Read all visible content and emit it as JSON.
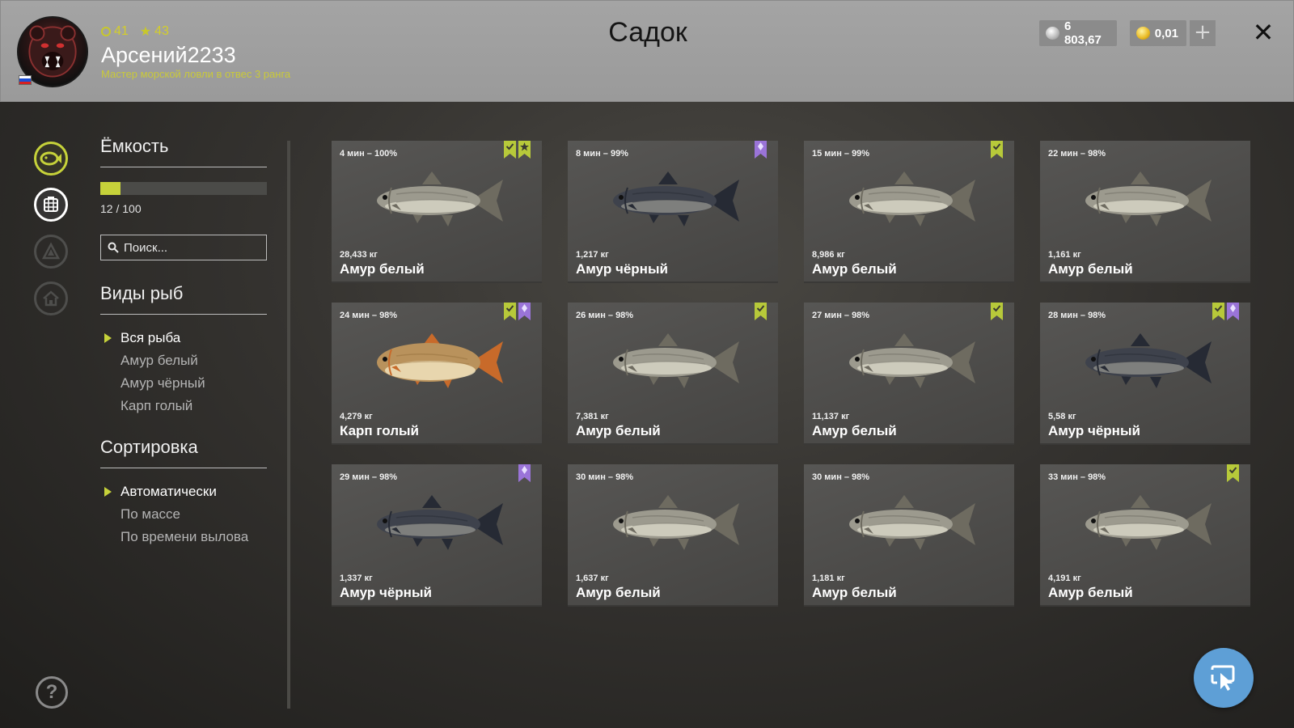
{
  "header": {
    "title": "Садок",
    "player": {
      "name": "Арсений2233",
      "level": "41",
      "rank": "43",
      "title": "Мастер морской ловли в отвес 3 ранга"
    },
    "currency": {
      "silver": "6 803,67",
      "gold": "0,01"
    },
    "add_button": "+",
    "close_button": "✕"
  },
  "sidebar": {
    "capacity_title": "Ёмкость",
    "capacity_text": "12 / 100",
    "capacity_fill": 0.12,
    "search_placeholder": "Поиск...",
    "species_title": "Виды рыб",
    "species": [
      {
        "label": "Вся рыба",
        "active": true
      },
      {
        "label": "Амур белый",
        "active": false
      },
      {
        "label": "Амур чёрный",
        "active": false
      },
      {
        "label": "Карп голый",
        "active": false
      }
    ],
    "sort_title": "Сортировка",
    "sort": [
      {
        "label": "Автоматически",
        "active": true
      },
      {
        "label": "По массе",
        "active": false
      },
      {
        "label": "По времени вылова",
        "active": false
      }
    ]
  },
  "colors": {
    "accent": "#c6d23a",
    "badge_green": "#b7c93a",
    "badge_purple": "#9a74d8",
    "action_blue": "#5e9fd6"
  },
  "fish": [
    {
      "time": "4 мин – 100%",
      "weight": "28,433 кг",
      "name": "Амур белый",
      "kind": "white",
      "badges": [
        "green-check",
        "green-star"
      ]
    },
    {
      "time": "8 мин – 99%",
      "weight": "1,217 кг",
      "name": "Амур чёрный",
      "kind": "black",
      "badges": [
        "purple-diamond"
      ]
    },
    {
      "time": "15 мин – 99%",
      "weight": "8,986 кг",
      "name": "Амур белый",
      "kind": "white",
      "badges": [
        "green-check"
      ]
    },
    {
      "time": "22 мин – 98%",
      "weight": "1,161 кг",
      "name": "Амур белый",
      "kind": "white",
      "badges": []
    },
    {
      "time": "24 мин – 98%",
      "weight": "4,279 кг",
      "name": "Карп голый",
      "kind": "carp",
      "badges": [
        "green-check",
        "purple-diamond"
      ]
    },
    {
      "time": "26 мин – 98%",
      "weight": "7,381 кг",
      "name": "Амур белый",
      "kind": "white",
      "badges": [
        "green-check"
      ]
    },
    {
      "time": "27 мин – 98%",
      "weight": "11,137 кг",
      "name": "Амур белый",
      "kind": "white",
      "badges": [
        "green-check"
      ]
    },
    {
      "time": "28 мин – 98%",
      "weight": "5,58 кг",
      "name": "Амур чёрный",
      "kind": "black",
      "badges": [
        "green-check",
        "purple-diamond"
      ]
    },
    {
      "time": "29 мин – 98%",
      "weight": "1,337 кг",
      "name": "Амур чёрный",
      "kind": "black",
      "badges": [
        "purple-diamond"
      ]
    },
    {
      "time": "30 мин – 98%",
      "weight": "1,637 кг",
      "name": "Амур белый",
      "kind": "white",
      "badges": []
    },
    {
      "time": "30 мин – 98%",
      "weight": "1,181 кг",
      "name": "Амур белый",
      "kind": "white",
      "badges": []
    },
    {
      "time": "33 мин – 98%",
      "weight": "4,191 кг",
      "name": "Амур белый",
      "kind": "white",
      "badges": [
        "green-check"
      ]
    }
  ],
  "help_button": "?"
}
